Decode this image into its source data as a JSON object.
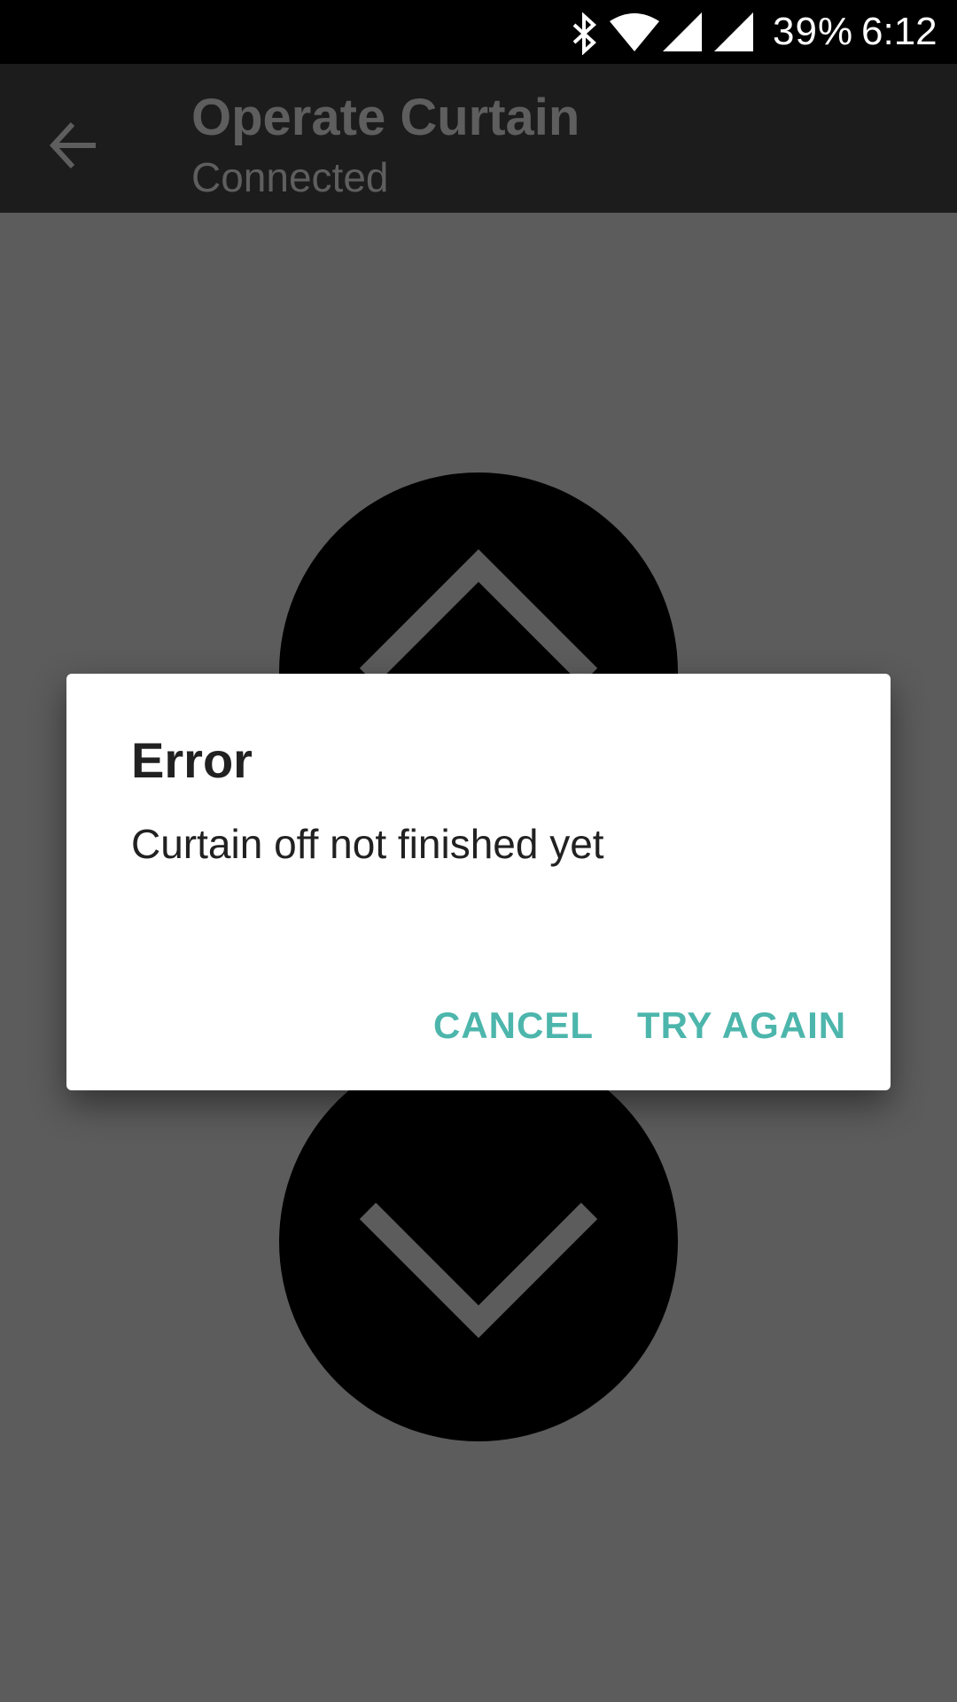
{
  "status_bar": {
    "battery": "39%",
    "time": "6:12",
    "icons": [
      "bluetooth-icon",
      "wifi-icon",
      "cell-signal-icon",
      "cell-signal-icon"
    ]
  },
  "app_bar": {
    "title": "Operate Curtain",
    "subtitle": "Connected",
    "back_icon": "arrow-back-icon"
  },
  "controls": {
    "up_icon": "chevron-up-icon",
    "down_icon": "chevron-down-icon"
  },
  "dialog": {
    "title": "Error",
    "message": "Curtain off not finished yet",
    "cancel_label": "CANCEL",
    "retry_label": "TRY AGAIN"
  },
  "colors": {
    "scrim_background": "#5c5c5c",
    "app_bar": "#1c1c1c",
    "accent": "#4db6ac",
    "dialog_text": "#212121"
  }
}
